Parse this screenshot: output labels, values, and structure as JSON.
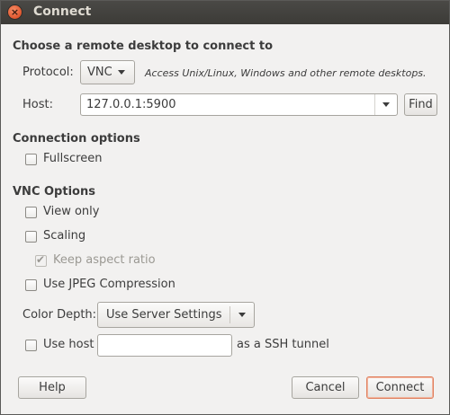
{
  "window": {
    "title": "Connect",
    "close_glyph": "×"
  },
  "remote": {
    "heading": "Choose a remote desktop to connect to",
    "protocol_label": "Protocol:",
    "protocol_value": "VNC",
    "protocol_description": "Access Unix/Linux, Windows and other remote desktops.",
    "host_label": "Host:",
    "host_value": "127.0.0.1:5900",
    "find_label": "Find"
  },
  "connection_options": {
    "heading": "Connection options",
    "fullscreen_label": "Fullscreen",
    "fullscreen_checked": false
  },
  "vnc_options": {
    "heading": "VNC Options",
    "view_only_label": "View only",
    "view_only_checked": false,
    "scaling_label": "Scaling",
    "scaling_checked": false,
    "keep_aspect_label": "Keep aspect ratio",
    "keep_aspect_checked": true,
    "jpeg_label": "Use JPEG Compression",
    "jpeg_checked": false,
    "color_depth_label": "Color Depth:",
    "color_depth_value": "Use Server Settings",
    "use_host_label": "Use host",
    "use_host_checked": false,
    "ssh_host_value": "",
    "ssh_suffix": "as a SSH tunnel"
  },
  "buttons": {
    "help": "Help",
    "cancel": "Cancel",
    "connect": "Connect"
  },
  "colors": {
    "titlebar": "#3c3b37",
    "window_bg": "#f2f1f0",
    "close_button": "#e0562e",
    "default_button_border": "#e0805f"
  },
  "icons": {
    "close": "close-icon",
    "dropdown": "chevron-down-icon",
    "checkmark": "checkmark-icon"
  }
}
